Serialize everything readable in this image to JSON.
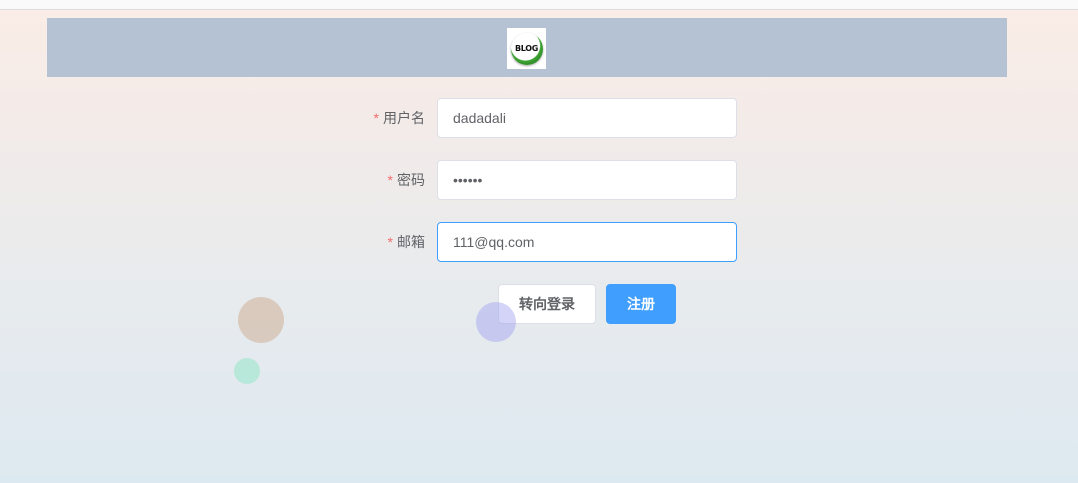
{
  "header": {
    "logo_text": "BLOG"
  },
  "form": {
    "username": {
      "required_mark": "*",
      "label": "用户名",
      "value": "dadadali"
    },
    "password": {
      "required_mark": "*",
      "label": "密码",
      "value": "dadada"
    },
    "email": {
      "required_mark": "*",
      "label": "邮箱",
      "value": "111@qq.com"
    }
  },
  "buttons": {
    "login_label": "转向登录",
    "register_label": "注册"
  },
  "colors": {
    "header_bg": "#b4c2d3",
    "primary": "#409eff",
    "required": "#f56c6c",
    "label_text": "#606266"
  }
}
